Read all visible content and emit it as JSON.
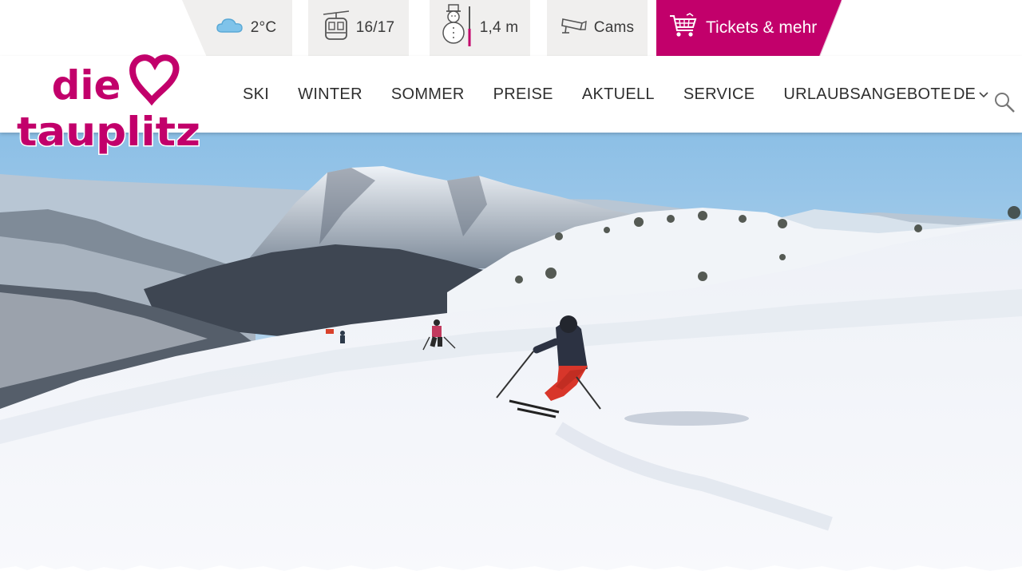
{
  "brand": {
    "logo_line1": "die",
    "logo_line2": "tauplitz",
    "color": "#c2006b"
  },
  "infobar": {
    "weather": {
      "icon": "cloud-icon",
      "value": "2°C"
    },
    "lifts": {
      "icon": "gondola-icon",
      "value": "16/17"
    },
    "snow": {
      "icon": "snowman-icon",
      "value": "1,4 m"
    },
    "cams": {
      "icon": "camera-icon",
      "label": "Cams"
    },
    "tickets": {
      "icon": "shopping-cart-icon",
      "label": "Tickets & mehr"
    }
  },
  "nav": {
    "items": [
      {
        "label": "SKI"
      },
      {
        "label": "WINTER"
      },
      {
        "label": "SOMMER"
      },
      {
        "label": "PREISE"
      },
      {
        "label": "AKTUELL"
      },
      {
        "label": "SERVICE"
      },
      {
        "label": "URLAUBSANGEBOTE"
      }
    ],
    "language": "DE",
    "language_icon": "chevron-down-icon",
    "search_icon": "search-icon"
  },
  "hero": {
    "image": "skiers-on-snowy-slope"
  }
}
